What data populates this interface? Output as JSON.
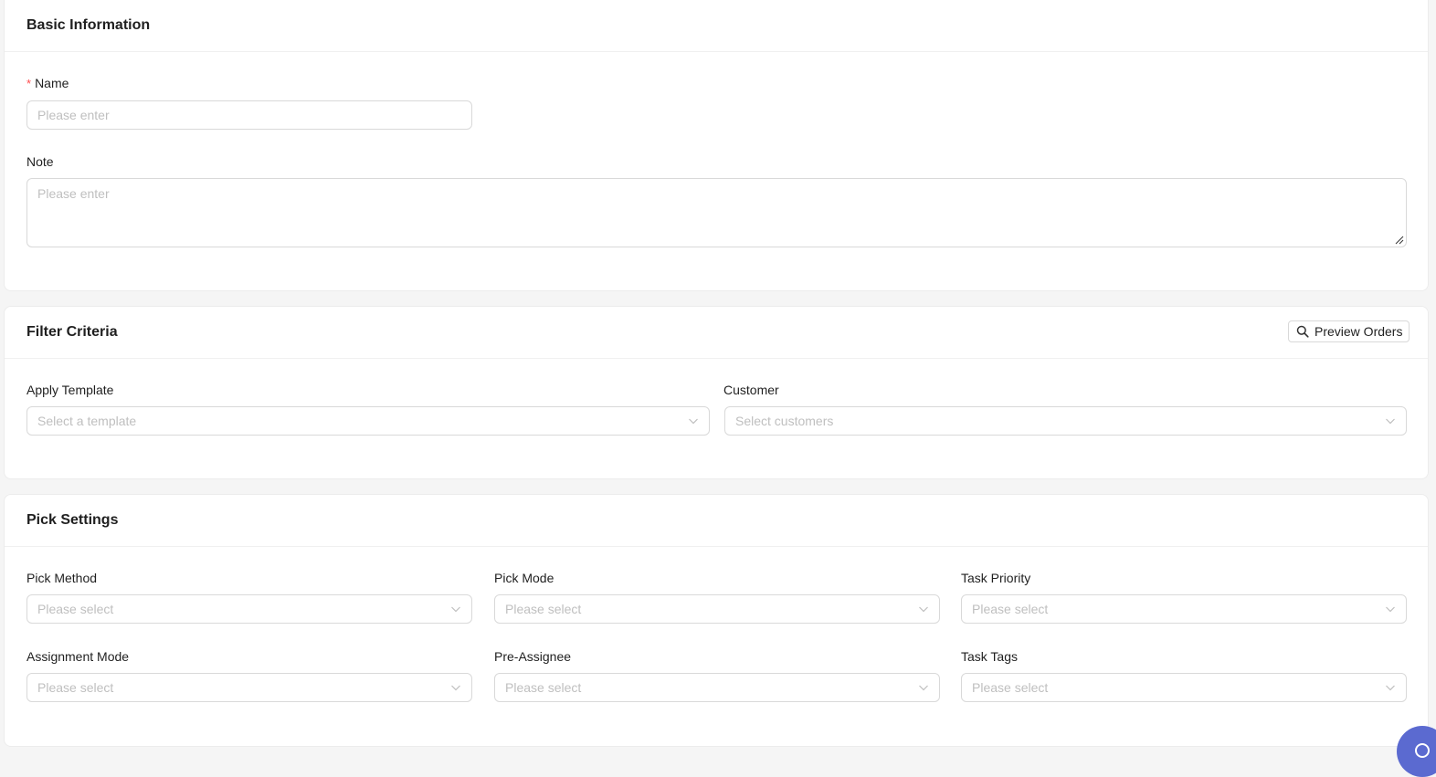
{
  "basic": {
    "title": "Basic Information",
    "name_label": "Name",
    "name_required": "*",
    "name_placeholder": "Please enter",
    "note_label": "Note",
    "note_placeholder": "Please enter"
  },
  "filter": {
    "title": "Filter Criteria",
    "preview_button": "Preview Orders",
    "template_label": "Apply Template",
    "template_placeholder": "Select a template",
    "customer_label": "Customer",
    "customer_placeholder": "Select customers"
  },
  "pick": {
    "title": "Pick Settings",
    "fields": [
      {
        "label": "Pick Method",
        "placeholder": "Please select"
      },
      {
        "label": "Pick Mode",
        "placeholder": "Please select"
      },
      {
        "label": "Task Priority",
        "placeholder": "Please select"
      },
      {
        "label": "Assignment Mode",
        "placeholder": "Please select"
      },
      {
        "label": "Pre-Assignee",
        "placeholder": "Please select"
      },
      {
        "label": "Task Tags",
        "placeholder": "Please select"
      }
    ]
  },
  "icons": {
    "select_arrow": "chevron-down-icon",
    "preview": "search-icon",
    "floating": "help-icon"
  },
  "colors": {
    "required": "#ff4d4f",
    "placeholder": "#bfbfbf",
    "border": "#d9d9d9",
    "floating_button": "#5b6ad0"
  }
}
